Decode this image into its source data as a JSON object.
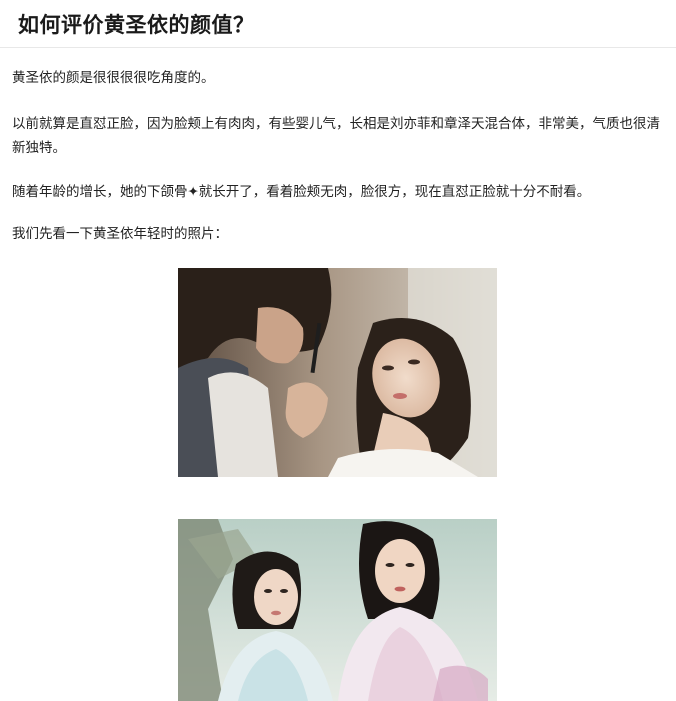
{
  "article": {
    "title": "如何评价黄圣依的颜值？",
    "paragraphs": [
      "黄圣依的颜是很很很很吃角度的。",
      "以前就算是直怼正脸，因为脸颊上有肉肉，有些婴儿气，长相是刘亦菲和章泽天混合体，非常美，气质也很清新独特。",
      "随着年龄的增长，她的下颌骨✦就长开了，看着脸颊无肉，脸很方，现在直怼正脸就十分不耐看。",
      "我们先看一下黄圣依年轻时的照片："
    ]
  }
}
